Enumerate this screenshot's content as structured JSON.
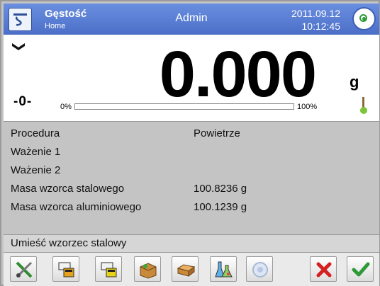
{
  "header": {
    "title": "Gęstość",
    "subtitle": "Home",
    "user": "Admin",
    "date": "2011.09.12",
    "time": "10:12:45"
  },
  "weighing": {
    "value": "0.000",
    "unit": "g",
    "zero_indicator": "-0-",
    "bar_min_label": "0%",
    "bar_max_label": "100%",
    "bar_fill_fraction": 0
  },
  "info": {
    "rows": [
      {
        "label": "Procedura",
        "value": "Powietrze"
      },
      {
        "label": "Ważenie 1",
        "value": ""
      },
      {
        "label": "Ważenie 2",
        "value": ""
      },
      {
        "label": "Masa wzorca stalowego",
        "value": "100.8236 g"
      },
      {
        "label": "Masa wzorca aluminiowego",
        "value": "100.1239 g"
      }
    ]
  },
  "message": "Umieść wzorzec stalowy",
  "colors": {
    "header": "#4b6fc7",
    "accept": "#2f9a3a",
    "cancel": "#d42020"
  },
  "toolbar_icons": [
    "tools-icon",
    "weigh-sample-icon",
    "weigh-sample-2-icon",
    "sample-box-icon",
    "brick-icon",
    "flasks-icon",
    "disabled-gear-icon",
    "cancel-icon",
    "accept-icon"
  ]
}
